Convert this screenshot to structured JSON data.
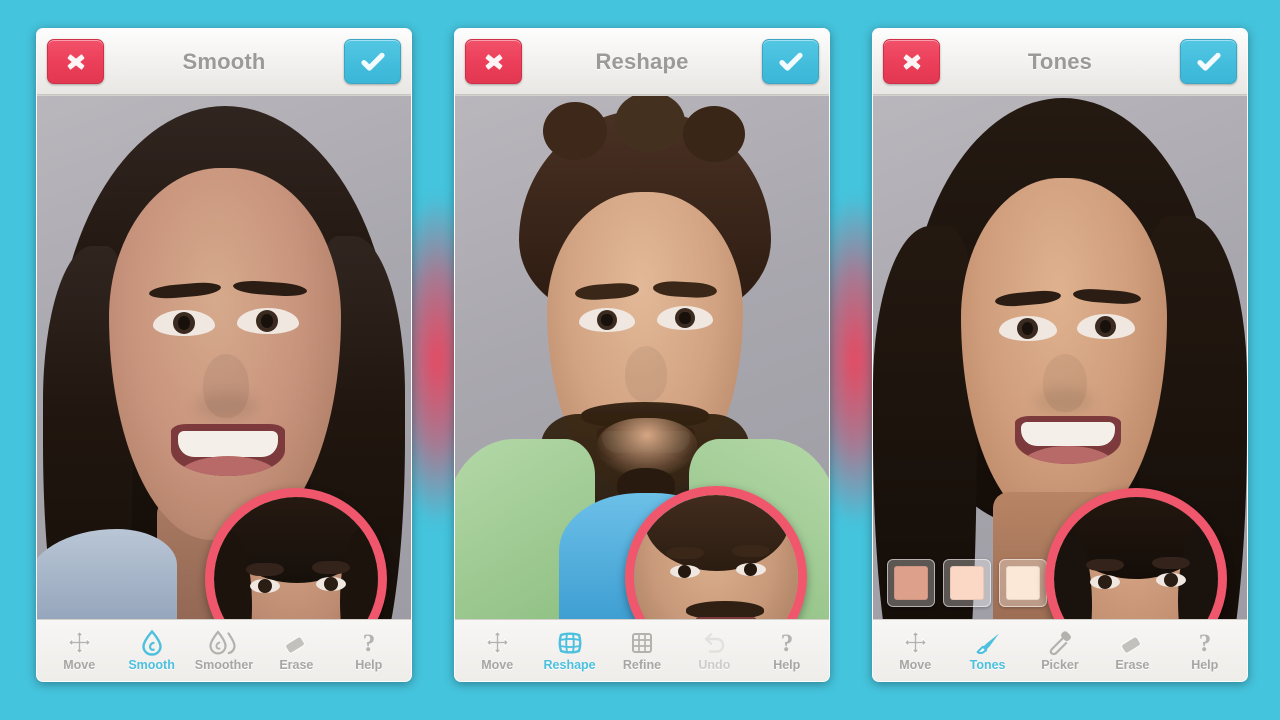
{
  "app": {
    "background_color": "#45c4dd",
    "accent_color": "#4cc0de",
    "cancel_color": "#ec3f5a",
    "confirm_color": "#45bedd",
    "magnifier_ring_color": "#f0566c",
    "glow_color": "#f43e56"
  },
  "panels": [
    {
      "id": "smooth",
      "titlebar": {
        "title": "Smooth",
        "cancel_label": "Cancel",
        "cancel_icon": "close-x-icon",
        "confirm_label": "Done",
        "confirm_icon": "checkmark-icon"
      },
      "subject": "woman-dark-hair",
      "magnifier": {
        "label": "before-after-preview",
        "visible": true
      },
      "swatches": [],
      "toolbar": [
        {
          "label": "Move",
          "icon": "move-arrows-icon",
          "state": "normal"
        },
        {
          "label": "Smooth",
          "icon": "droplet-icon",
          "state": "active"
        },
        {
          "label": "Smoother",
          "icon": "double-droplet-icon",
          "state": "normal"
        },
        {
          "label": "Erase",
          "icon": "eraser-icon",
          "state": "normal"
        },
        {
          "label": "Help",
          "icon": "question-mark-icon",
          "state": "normal"
        }
      ]
    },
    {
      "id": "reshape",
      "titlebar": {
        "title": "Reshape",
        "cancel_label": "Cancel",
        "cancel_icon": "close-x-icon",
        "confirm_label": "Done",
        "confirm_icon": "checkmark-icon"
      },
      "subject": "man-beard-green-jacket",
      "magnifier": {
        "label": "before-after-preview",
        "visible": true
      },
      "swatches": [],
      "toolbar": [
        {
          "label": "Move",
          "icon": "move-arrows-icon",
          "state": "normal"
        },
        {
          "label": "Reshape",
          "icon": "warp-grid-icon",
          "state": "active"
        },
        {
          "label": "Refine",
          "icon": "fine-grid-icon",
          "state": "normal"
        },
        {
          "label": "Undo",
          "icon": "undo-icon",
          "state": "disabled"
        },
        {
          "label": "Help",
          "icon": "question-mark-icon",
          "state": "normal"
        }
      ]
    },
    {
      "id": "tones",
      "titlebar": {
        "title": "Tones",
        "cancel_label": "Cancel",
        "cancel_icon": "close-x-icon",
        "confirm_label": "Done",
        "confirm_icon": "checkmark-icon"
      },
      "subject": "woman-long-hair",
      "magnifier": {
        "label": "before-after-preview",
        "visible": true
      },
      "swatches": [
        {
          "name": "tone-swatch-1",
          "color": "#dda08b",
          "selected": true
        },
        {
          "name": "tone-swatch-2",
          "color": "#fbd7c6",
          "selected": false
        },
        {
          "name": "tone-swatch-3",
          "color": "#fbe8d6",
          "selected": false
        }
      ],
      "toolbar": [
        {
          "label": "Move",
          "icon": "move-arrows-icon",
          "state": "normal"
        },
        {
          "label": "Tones",
          "icon": "brush-icon",
          "state": "active"
        },
        {
          "label": "Picker",
          "icon": "eyedropper-icon",
          "state": "normal"
        },
        {
          "label": "Erase",
          "icon": "eraser-icon",
          "state": "normal"
        },
        {
          "label": "Help",
          "icon": "question-mark-icon",
          "state": "normal"
        }
      ]
    }
  ]
}
